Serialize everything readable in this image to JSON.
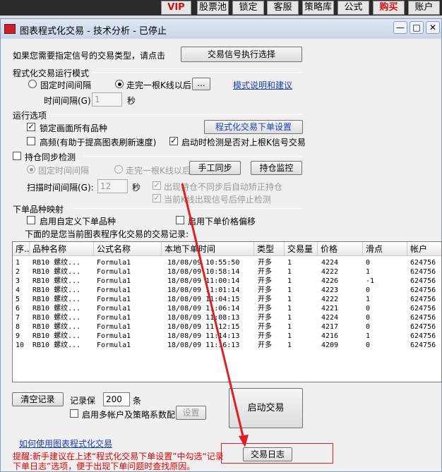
{
  "toolbar": {
    "vip": "VIP",
    "stock_pool": "股票池",
    "lock": "锁定",
    "service": "客服",
    "strategy": "策略库",
    "formula": "公式",
    "buy": "购买",
    "account": "账户"
  },
  "window": {
    "title": "图表程式化交易 - 技术分析 - 已停止",
    "app_icon_label": "文华财经"
  },
  "signal": {
    "prompt": "如果您需要指定信号的交易类型，请点击",
    "button": "交易信号执行选择"
  },
  "mode": {
    "section_label": "程式化交易运行模式",
    "fixed_interval": "固定时间间隔",
    "after_kline": "走完一根K线以后",
    "more_button": "...",
    "help_link": "模式说明和建议",
    "interval_label": "时间间隔(G):",
    "interval_value": "1",
    "interval_unit": "秒",
    "selected": "after_kline"
  },
  "options": {
    "section_label": "运行选项",
    "lock_all": "锁定画面所有品种",
    "lock_all_checked": true,
    "order_settings_button": "程式化交易下单设置",
    "high_freq": "高频(有助于提高图表刷新速度)",
    "high_freq_checked": false,
    "check_last_signal": "启动时检测是否对上根K信号交易",
    "check_last_signal_checked": true
  },
  "position_sync": {
    "label": "持仓同步检测",
    "checked": false,
    "fixed_interval": "固定时间间隔",
    "after_kline": "走完一根K线以后",
    "manual_sync_button": "手工同步",
    "monitor_button": "持仓监控",
    "scan_label": "扫描时间间隔(G):",
    "scan_value": "12",
    "scan_unit": "秒",
    "auto_fix": "出现持仓不同步后自动矫正持仓",
    "auto_fix_checked": true,
    "stop_on_signal": "当前K线出现信号后停止检测",
    "stop_on_signal_checked": true
  },
  "mapping": {
    "section_label": "下单品种映射",
    "custom_symbol": "启用自定义下单品种",
    "custom_symbol_checked": false,
    "price_offset": "启用下单价格偏移",
    "price_offset_checked": false
  },
  "records": {
    "caption": "下面的是您当前图表程序化交易的交易记录:",
    "columns": [
      "序...",
      "品种名称",
      "公式名称",
      "本地下单时间",
      "类型",
      "交易量",
      "价格",
      "滑点",
      "帐户"
    ],
    "rows": [
      [
        "1",
        "RB10 螺纹...",
        "Formula1",
        "18/08/09 10:55:50",
        "开多",
        "1",
        "4224",
        "0",
        "624756"
      ],
      [
        "2",
        "RB10 螺纹...",
        "Formula1",
        "18/08/09 10:58:14",
        "开多",
        "1",
        "4222",
        "1",
        "624756"
      ],
      [
        "3",
        "RB10 螺纹...",
        "Formula1",
        "18/08/09 11:00:14",
        "开多",
        "1",
        "4226",
        "-1",
        "624756"
      ],
      [
        "4",
        "RB10 螺纹...",
        "Formula1",
        "18/08/09 11:01:14",
        "开多",
        "1",
        "4223",
        "0",
        "624756"
      ],
      [
        "5",
        "RB10 螺纹...",
        "Formula1",
        "18/08/09 11:04:15",
        "开多",
        "1",
        "4222",
        "1",
        "624756"
      ],
      [
        "6",
        "RB10 螺纹...",
        "Formula1",
        "18/08/09 11:06:14",
        "开多",
        "1",
        "4221",
        "0",
        "624756"
      ],
      [
        "7",
        "RB10 螺纹...",
        "Formula1",
        "18/08/09 11:08:13",
        "开多",
        "1",
        "4224",
        "0",
        "624756"
      ],
      [
        "8",
        "RB10 螺纹...",
        "Formula1",
        "18/08/09 11:12:15",
        "开多",
        "1",
        "4217",
        "0",
        "624756"
      ],
      [
        "9",
        "RB10 螺纹...",
        "Formula1",
        "18/08/09 11:14:13",
        "开多",
        "1",
        "4216",
        "1",
        "624756"
      ],
      [
        "10",
        "RB10 螺纹...",
        "Formula1",
        "18/08/09 11:16:13",
        "开多",
        "1",
        "4209",
        "0",
        "624756"
      ]
    ]
  },
  "bottom": {
    "clear_button": "清空记录",
    "keep_label": "记录保",
    "keep_value": "200",
    "keep_unit": "条",
    "multi_account": "启用多帐户及策略系数配",
    "multi_account_checked": false,
    "settings_button": "设置",
    "start_button": "启动交易",
    "help_link": "如何使用图表程式化交易",
    "log_button": "交易日志",
    "tip_line1": "提醒:新手建议在上述“程式化交易下单设置”中勾选“记录",
    "tip_line2": "下单日志”选项，便于出现下单问题时查找原因。"
  },
  "colors": {
    "annotation_red": "#e02020",
    "link_blue": "#1a3fb0"
  }
}
